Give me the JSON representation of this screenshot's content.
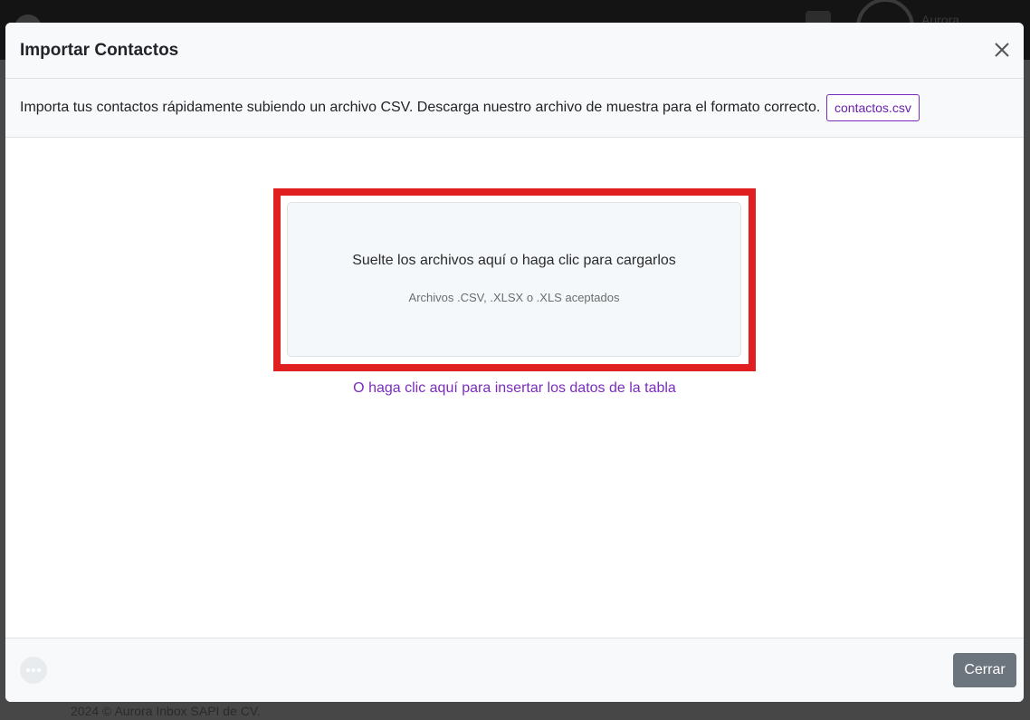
{
  "background": {
    "user_name": "Aurora",
    "footer_text": "2024 © Aurora Inbox SAPI de CV."
  },
  "modal": {
    "title": "Importar Contactos",
    "info_text": "Importa tus contactos rápidamente subiendo un archivo CSV. Descarga nuestro archivo de muestra para el formato correcto.",
    "sample_file_label": "contactos.csv",
    "dropzone": {
      "title": "Suelte los archivos aquí o haga clic para cargarlos",
      "subtitle": "Archivos .CSV, .XLSX o .XLS aceptados"
    },
    "table_link": "O haga clic aquí para insertar los datos de la tabla",
    "close_button_label": "Cerrar"
  },
  "colors": {
    "accent": "#7b2cbf",
    "highlight": "#e02020",
    "secondary_button": "#6c757d"
  },
  "icons": [
    "close-icon",
    "chat-icon",
    "calendar-icon"
  ]
}
